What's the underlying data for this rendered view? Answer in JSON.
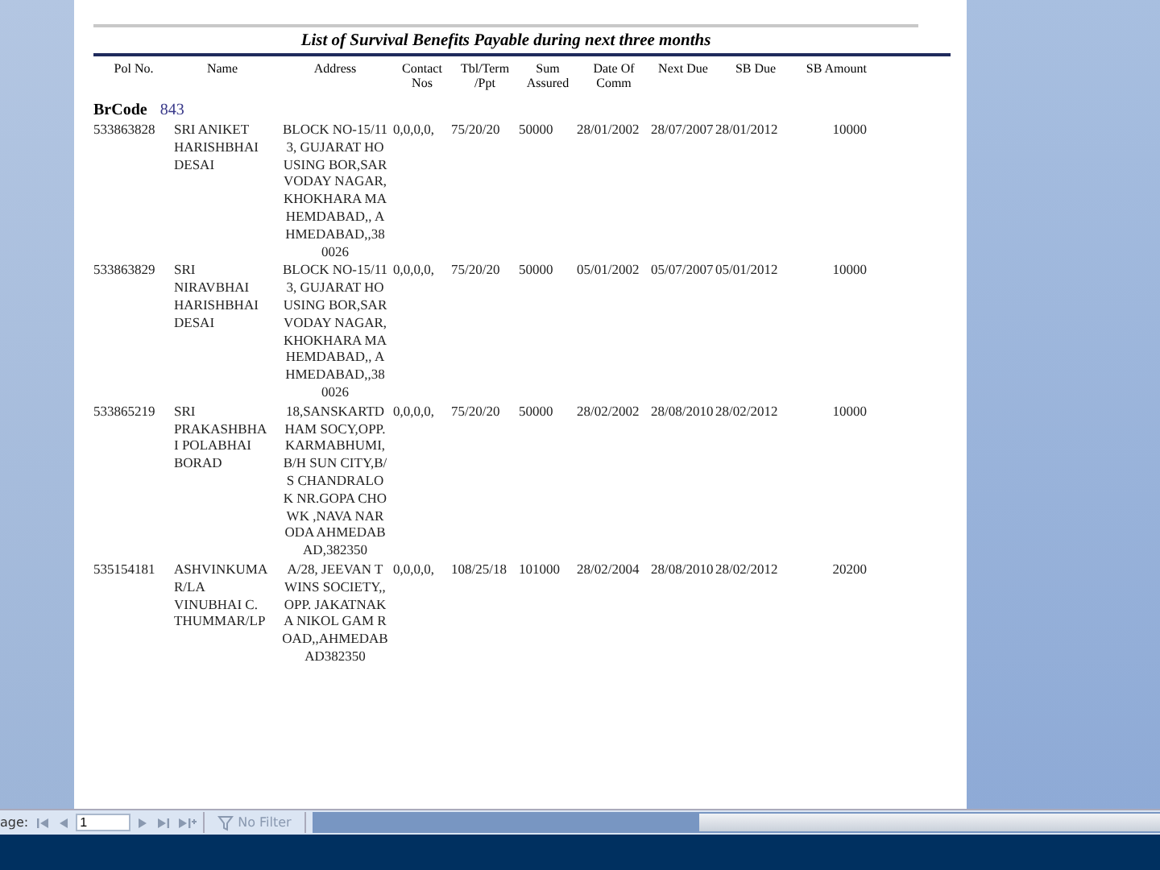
{
  "report": {
    "title": "List of Survival Benefits Payable during next three months",
    "columns": [
      "Pol No.",
      "Name",
      "Address",
      "Contact Nos",
      "Tbl/Term /Ppt",
      "Sum Assured",
      "Date Of Comm",
      "Next Due",
      "SB Due",
      "SB Amount"
    ],
    "branch_label": "BrCode",
    "branch_code": "843",
    "rows": [
      {
        "pol_no": "533863828",
        "name": "SRI ANIKET HARISHBHAI DESAI",
        "address": "BLOCK NO-15/113, GUJARAT HOUSING BOR,SARVODAY NAGAR,KHOKHARA MAHEMDABAD,, AHMEDABAD,,380026",
        "contact": "0,0,0,0,",
        "ppt": "75/20/20",
        "sum": "50000",
        "comm": "28/01/2002",
        "next_due": "28/07/2007",
        "sb_due": "28/01/2012",
        "amount": "10000"
      },
      {
        "pol_no": "533863829",
        "name": "SRI NIRAVBHAI HARISHBHAI DESAI",
        "address": "BLOCK NO-15/113, GUJARAT HOUSING BOR,SARVODAY NAGAR,KHOKHARA MAHEMDABAD,, AHMEDABAD,,380026",
        "contact": "0,0,0,0,",
        "ppt": "75/20/20",
        "sum": "50000",
        "comm": "05/01/2002",
        "next_due": "05/07/2007",
        "sb_due": "05/01/2012",
        "amount": "10000"
      },
      {
        "pol_no": "533865219",
        "name": "SRI PRAKASHBHAI POLABHAI BORAD",
        "address": "18,SANSKARTDHAM SOCY,OPP.KARMABHUMI,B/H SUN CITY,B/S CHANDRALOK NR.GOPA CHOWK ,NAVA NARODA AHMEDABAD,382350",
        "contact": "0,0,0,0,",
        "ppt": "75/20/20",
        "sum": "50000",
        "comm": "28/02/2002",
        "next_due": "28/08/2010",
        "sb_due": "28/02/2012",
        "amount": "10000"
      },
      {
        "pol_no": "535154181",
        "name": "ASHVINKUMAR/LA VINUBHAI C. THUMMAR/LP",
        "address": "A/28, JEEVAN TWINS SOCIETY,,OPP. JAKATNAKA NIKOL GAM ROAD,,AHMEDABAD382350",
        "contact": "0,0,0,0,",
        "ppt": "108/25/18",
        "sum": "101000",
        "comm": "28/02/2004",
        "next_due": "28/08/2010",
        "sb_due": "28/02/2012",
        "amount": "20200"
      }
    ]
  },
  "navigation": {
    "page_label": "age:",
    "page_number": "1",
    "filter_label": "No Filter"
  }
}
